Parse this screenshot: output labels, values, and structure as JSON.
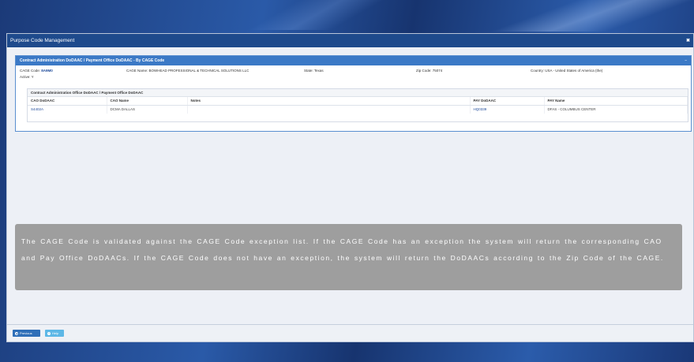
{
  "window": {
    "title": "Purpose Code Management",
    "close_label": "✖"
  },
  "panel": {
    "title": "Contract Administration DoDAAC / Payment Office DoDAAC - By CAGE Code",
    "collapse_label": "–",
    "info": {
      "cage_code_label": "CAGE Code:",
      "cage_code_value": "8A9M0",
      "cage_name": "CAGE Name: BOWHEAD PROFESSIONAL & TECHNICAL SOLUTIONS LLC",
      "state": "State: Texas",
      "zip": "Zip Code: 75074",
      "country": "Country: USA - United States of America (the)",
      "active": "Active: Y"
    },
    "table": {
      "title": "Contract Administration Office DoDAAC / Payment Office DoDAAC",
      "columns": [
        "CAO DoDAAC",
        "CAO Name",
        "Notes",
        "PAY DoDAAC",
        "PAY Name"
      ],
      "rows": [
        {
          "cao_dodaac": "S4402A",
          "cao_name": "DCMA DALLAS",
          "notes": "",
          "pay_dodaac": "HQ0339",
          "pay_name": "DFAS - COLUMBUS CENTER"
        }
      ]
    }
  },
  "overlay": {
    "text": "The CAGE Code is validated against the CAGE Code exception list. If the CAGE Code has an exception the system will return the corresponding CAO and Pay Office DoDAACs. If the CAGE Code does not have an exception, the system will return the DoDAACs according to the Zip Code of the CAGE."
  },
  "footer": {
    "previous_label": "Previous",
    "help_label": "Help"
  }
}
